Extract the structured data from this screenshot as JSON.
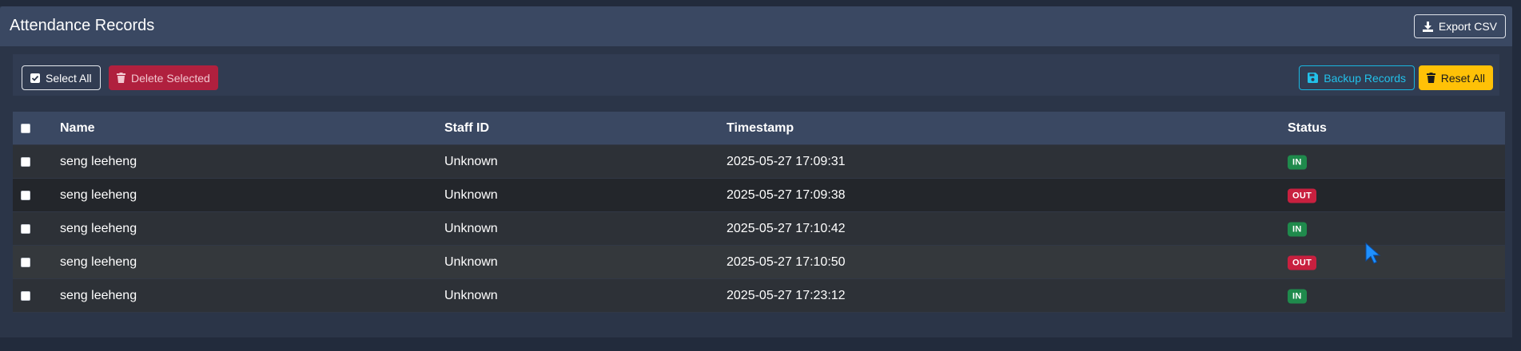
{
  "header": {
    "title": "Attendance Records",
    "export_label": "Export CSV"
  },
  "toolbar": {
    "select_all_label": "Select All",
    "delete_selected_label": "Delete Selected",
    "backup_label": "Backup Records",
    "reset_label": "Reset All"
  },
  "table": {
    "columns": [
      "Name",
      "Staff ID",
      "Timestamp",
      "Status"
    ],
    "rows": [
      {
        "name": "seng leeheng",
        "staff_id": "Unknown",
        "timestamp": "2025-05-27 17:09:31",
        "status": "IN"
      },
      {
        "name": "seng leeheng",
        "staff_id": "Unknown",
        "timestamp": "2025-05-27 17:09:38",
        "status": "OUT"
      },
      {
        "name": "seng leeheng",
        "staff_id": "Unknown",
        "timestamp": "2025-05-27 17:10:42",
        "status": "IN"
      },
      {
        "name": "seng leeheng",
        "staff_id": "Unknown",
        "timestamp": "2025-05-27 17:10:50",
        "status": "OUT"
      },
      {
        "name": "seng leeheng",
        "staff_id": "Unknown",
        "timestamp": "2025-05-27 17:23:12",
        "status": "IN"
      }
    ]
  },
  "colors": {
    "status_in": "#1f8a4c",
    "status_out": "#c8203f",
    "row_bg": [
      "#2d3137",
      "#23262b",
      "#2d3137",
      "#34383c",
      "#2d3137"
    ]
  },
  "icons": {
    "export": "download-icon",
    "select_all": "check-square-icon",
    "delete": "trash-icon",
    "backup": "floppy-disk-icon",
    "reset": "trash-icon"
  }
}
